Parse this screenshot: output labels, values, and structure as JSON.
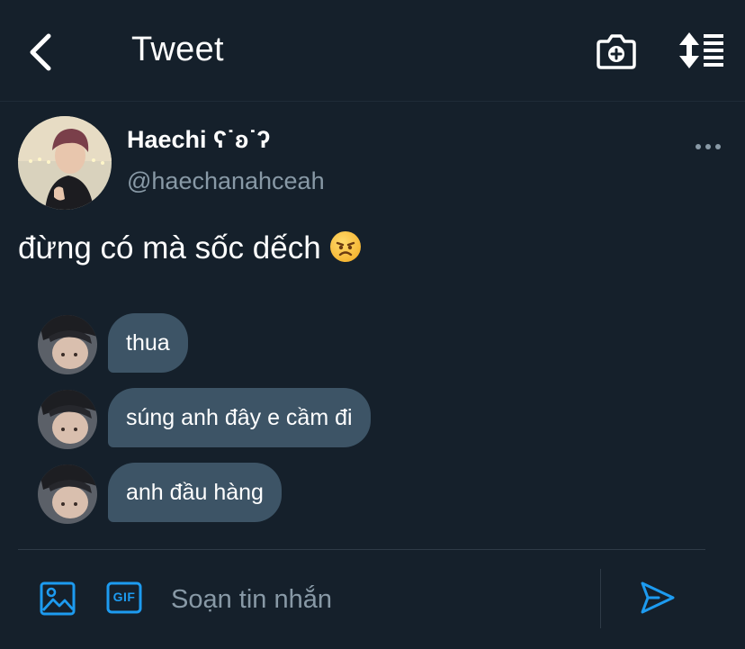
{
  "header": {
    "title": "Tweet",
    "back_icon": "chevron-left-icon",
    "camera_icon": "camera-plus-icon",
    "sort_icon": "sort-list-icon"
  },
  "tweet": {
    "author_name": "Haechi ʕ˙ʚ˙ʔ",
    "handle": "@haechanahceah",
    "text": "đừng có mà sốc dếch",
    "emoji": "angry-face-emoji"
  },
  "messages": [
    {
      "text": "thua"
    },
    {
      "text": "súng anh đây e cầm đi"
    },
    {
      "text": "anh đầu hàng"
    }
  ],
  "composer": {
    "placeholder": "Soạn tin nhắn",
    "gif_label": "GIF"
  },
  "colors": {
    "background": "#15202b",
    "accent": "#1d9bf0",
    "bubble": "#3d5466",
    "muted_text": "#8899a6"
  }
}
